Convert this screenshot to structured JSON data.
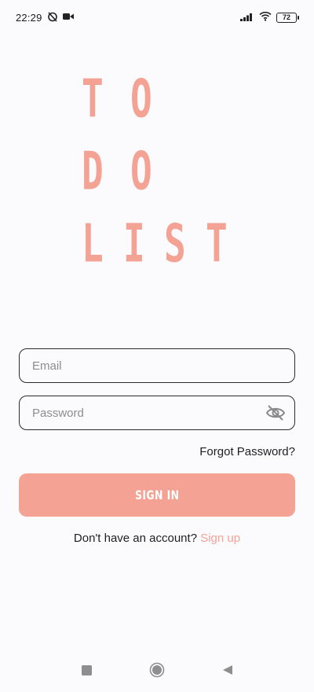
{
  "status_bar": {
    "time": "22:29",
    "battery": "72"
  },
  "logo": {
    "rows": [
      [
        "T",
        "O"
      ],
      [
        "D",
        "O"
      ],
      [
        "L",
        "I",
        "S",
        "T"
      ]
    ],
    "color": "#f3a294"
  },
  "form": {
    "email_placeholder": "Email",
    "password_placeholder": "Password",
    "forgot_label": "Forgot Password?",
    "signin_label": "SIGN IN",
    "no_account_text": "Don't have an account?",
    "signup_label": "Sign up"
  },
  "colors": {
    "accent": "#f3a294",
    "background": "#fbfbfd"
  },
  "icons": {
    "password_toggle": "eye-off-icon",
    "nav_recent": "square-icon",
    "nav_home": "circle-icon",
    "nav_back": "triangle-back-icon"
  }
}
